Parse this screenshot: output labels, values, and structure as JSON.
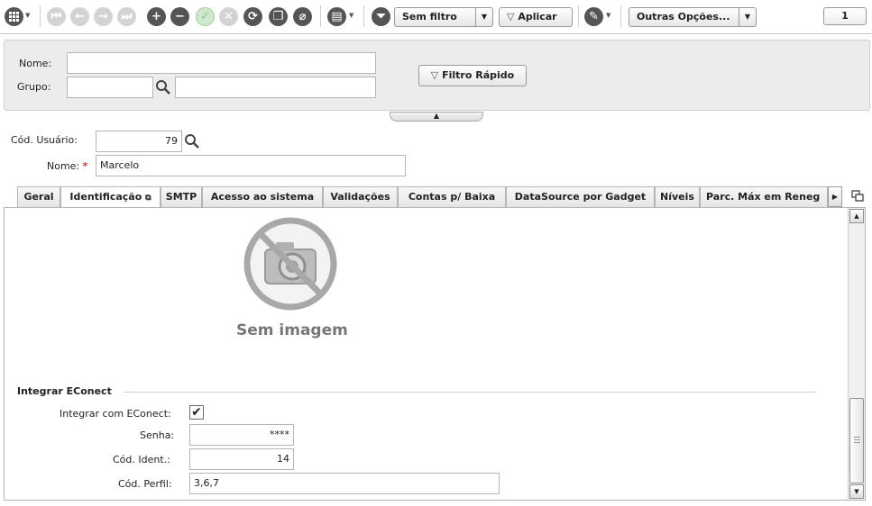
{
  "toolbar": {
    "filter_label": "Sem filtro",
    "apply_label": "Aplicar",
    "more_options_label": "Outras Opções...",
    "page_counter": "1"
  },
  "filter": {
    "name_label": "Nome:",
    "name_value": "",
    "group_label": "Grupo:",
    "group_code_value": "",
    "group_desc_value": "",
    "quick_filter_label": "Filtro Rápido"
  },
  "record": {
    "user_code_label": "Cód. Usuário:",
    "user_code_value": "79",
    "name_label": "Nome:",
    "name_required_mark": "*",
    "name_value": "Marcelo"
  },
  "tabs": [
    {
      "label": "Geral"
    },
    {
      "label": "Identificação"
    },
    {
      "label": "SMTP"
    },
    {
      "label": "Acesso ao sistema"
    },
    {
      "label": "Validações"
    },
    {
      "label": "Contas p/ Baixa"
    },
    {
      "label": "DataSource por Gadget"
    },
    {
      "label": "Níveis"
    },
    {
      "label": "Parc. Máx em Reneg"
    }
  ],
  "identification": {
    "no_image_label": "Sem imagem",
    "section_title": "Integrar EConect",
    "integrate_label": "Integrar com EConect:",
    "integrate_checked": true,
    "password_label": "Senha:",
    "password_value": "****",
    "ident_code_label": "Cód. Ident.:",
    "ident_code_value": "14",
    "profile_code_label": "Cód. Perfil:",
    "profile_code_value": "3,6,7"
  },
  "colors": {
    "accent_dark_icon": "#555555",
    "required_mark": "#dd3333",
    "panel_bg": "#ececec"
  }
}
